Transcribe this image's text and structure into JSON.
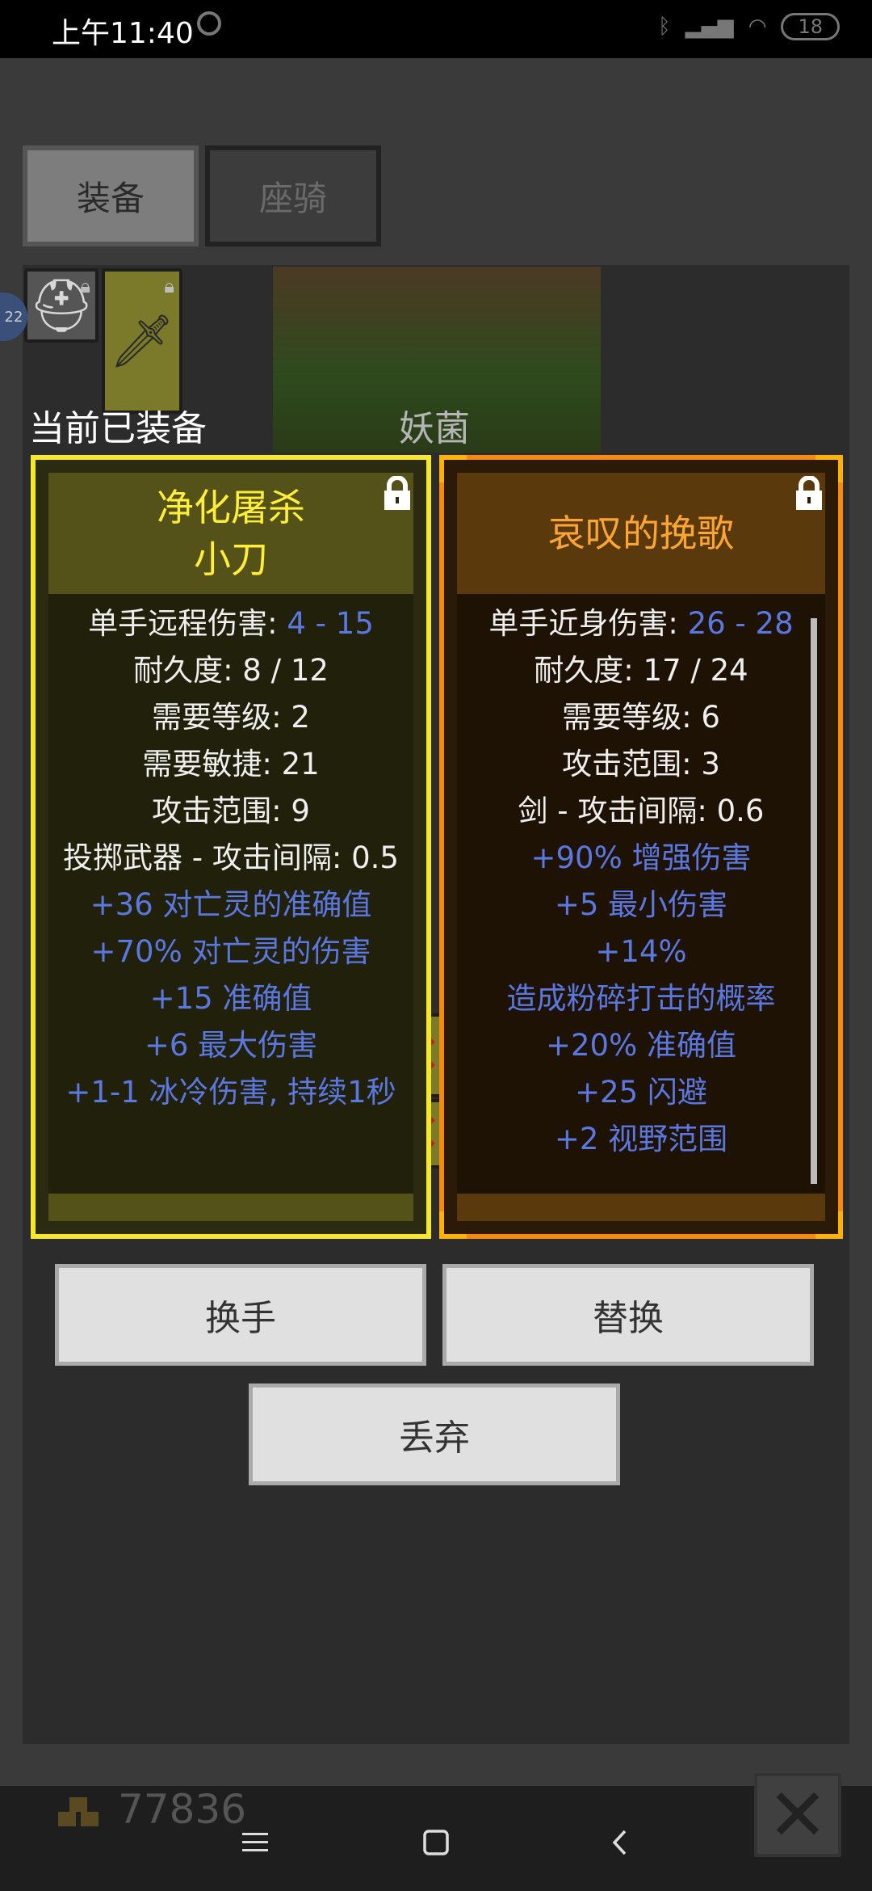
{
  "status_bar": {
    "time": "上午11:40",
    "icons": [
      "alarm-icon",
      "bluetooth-icon",
      "signal-icon",
      "wifi-icon"
    ],
    "battery": "18"
  },
  "tabs": [
    {
      "label": "装备",
      "selected": true
    },
    {
      "label": "座骑",
      "selected": false
    }
  ],
  "labels": {
    "current_equipped": "当前已装备",
    "monster_name": "妖菌"
  },
  "cards": [
    {
      "title_lines": [
        "净化屠杀",
        "小刀"
      ],
      "border_color": "#f5e72a",
      "title_color": "#ffef3a",
      "locked": true,
      "stats": [
        {
          "label": "单手远程伤害: ",
          "value": "4 - 15"
        },
        {
          "text": "耐久度: 8 / 12"
        },
        {
          "text": "需要等级: 2"
        },
        {
          "text": "需要敏捷: 21"
        },
        {
          "text": "攻击范围: 9"
        },
        {
          "text": "投掷武器 - 攻击间隔: 0.5"
        },
        {
          "text": "+36 对亡灵的准确值",
          "bonus": true
        },
        {
          "text": "+70% 对亡灵的伤害",
          "bonus": true
        },
        {
          "text": "+15 准确值",
          "bonus": true
        },
        {
          "text": "+6 最大伤害",
          "bonus": true
        },
        {
          "text": "+1-1 冰冷伤害, 持续1秒",
          "bonus": true
        }
      ]
    },
    {
      "title_lines": [
        "哀叹的挽歌"
      ],
      "border_color": "#f58a0c",
      "title_color": "#ffa533",
      "locked": true,
      "stats": [
        {
          "label": "单手近身伤害: ",
          "value": "26 - 28"
        },
        {
          "text": "耐久度: 17 / 24"
        },
        {
          "text": "需要等级: 6"
        },
        {
          "text": "攻击范围: 3"
        },
        {
          "text": "剑 - 攻击间隔: 0.6"
        },
        {
          "text": "+90% 增强伤害",
          "bonus": true
        },
        {
          "text": "+5 最小伤害",
          "bonus": true
        },
        {
          "text": "+14%",
          "bonus": true
        },
        {
          "text": "造成粉碎打击的概率",
          "bonus": true
        },
        {
          "text": "+20% 准确值",
          "bonus": true
        },
        {
          "text": "+25 闪避",
          "bonus": true
        },
        {
          "text": "+2 视野范围",
          "bonus": true
        }
      ]
    }
  ],
  "buttons": {
    "swap_hand": "换手",
    "replace": "替换",
    "discard": "丢弃"
  },
  "footer": {
    "gold": "77836",
    "side_badge": "22"
  },
  "colors": {
    "bonus_text": "#5b78e0",
    "unique_border": "#f5e72a",
    "set_border": "#f58a0c"
  }
}
